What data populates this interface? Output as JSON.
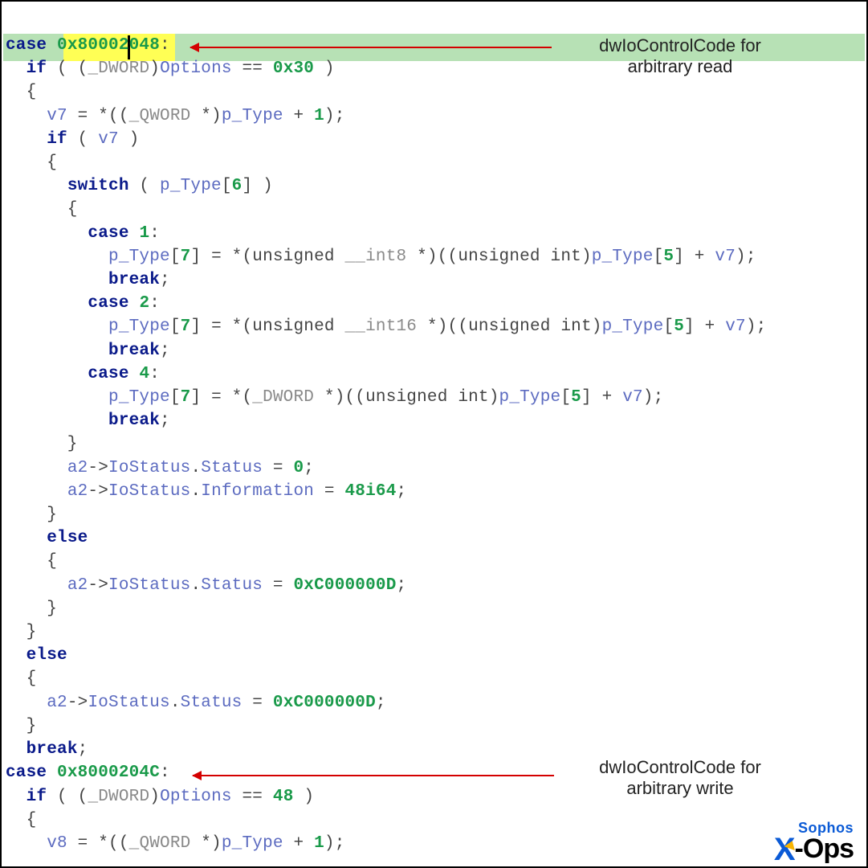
{
  "annotations": {
    "top": {
      "line1": "dwIoControlCode for",
      "line2": "arbitrary read"
    },
    "bottom": {
      "line1": "dwIoControlCode for",
      "line2": "arbitrary write"
    }
  },
  "logo": {
    "brand": "Sophos",
    "product_x": "X",
    "product_rest": "-Ops"
  },
  "code": {
    "l01_a": "case ",
    "l01_b": "0x80002048",
    "l01_c": ":",
    "l02_a": "  ",
    "l02_b": "if",
    "l02_c": " ( (",
    "l02_d": "_DWORD",
    "l02_e": ")",
    "l02_f": "Options",
    "l02_g": " == ",
    "l02_h": "0x30",
    "l02_i": " )",
    "l03": "  {",
    "l04_a": "    ",
    "l04_b": "v7",
    "l04_c": " = *((",
    "l04_d": "_QWORD",
    "l04_e": " *)",
    "l04_f": "p_Type",
    "l04_g": " + ",
    "l04_h": "1",
    "l04_i": ");",
    "l05_a": "    ",
    "l05_b": "if",
    "l05_c": " ( ",
    "l05_d": "v7",
    "l05_e": " )",
    "l06": "    {",
    "l07_a": "      ",
    "l07_b": "switch",
    "l07_c": " ( ",
    "l07_d": "p_Type",
    "l07_e": "[",
    "l07_f": "6",
    "l07_g": "] )",
    "l08": "      {",
    "l09_a": "        ",
    "l09_b": "case",
    "l09_c": " ",
    "l09_d": "1",
    "l09_e": ":",
    "l10_a": "          ",
    "l10_b": "p_Type",
    "l10_c": "[",
    "l10_d": "7",
    "l10_e": "] = *(unsigned ",
    "l10_f": "__int8",
    "l10_g": " *)((unsigned int)",
    "l10_h": "p_Type",
    "l10_i": "[",
    "l10_j": "5",
    "l10_k": "] + ",
    "l10_l": "v7",
    "l10_m": ");",
    "l11_a": "          ",
    "l11_b": "break",
    "l11_c": ";",
    "l12_a": "        ",
    "l12_b": "case",
    "l12_c": " ",
    "l12_d": "2",
    "l12_e": ":",
    "l13_a": "          ",
    "l13_b": "p_Type",
    "l13_c": "[",
    "l13_d": "7",
    "l13_e": "] = *(unsigned ",
    "l13_f": "__int16",
    "l13_g": " *)((unsigned int)",
    "l13_h": "p_Type",
    "l13_i": "[",
    "l13_j": "5",
    "l13_k": "] + ",
    "l13_l": "v7",
    "l13_m": ");",
    "l14_a": "          ",
    "l14_b": "break",
    "l14_c": ";",
    "l15_a": "        ",
    "l15_b": "case",
    "l15_c": " ",
    "l15_d": "4",
    "l15_e": ":",
    "l16_a": "          ",
    "l16_b": "p_Type",
    "l16_c": "[",
    "l16_d": "7",
    "l16_e": "] = *(",
    "l16_f": "_DWORD",
    "l16_g": " *)((unsigned int)",
    "l16_h": "p_Type",
    "l16_i": "[",
    "l16_j": "5",
    "l16_k": "] + ",
    "l16_l": "v7",
    "l16_m": ");",
    "l17_a": "          ",
    "l17_b": "break",
    "l17_c": ";",
    "l18": "      }",
    "l19_a": "      ",
    "l19_b": "a2",
    "l19_c": "->",
    "l19_d": "IoStatus",
    "l19_e": ".",
    "l19_f": "Status",
    "l19_g": " = ",
    "l19_h": "0",
    "l19_i": ";",
    "l20_a": "      ",
    "l20_b": "a2",
    "l20_c": "->",
    "l20_d": "IoStatus",
    "l20_e": ".",
    "l20_f": "Information",
    "l20_g": " = ",
    "l20_h": "48i64",
    "l20_i": ";",
    "l21": "    }",
    "l22_a": "    ",
    "l22_b": "else",
    "l23": "    {",
    "l24_a": "      ",
    "l24_b": "a2",
    "l24_c": "->",
    "l24_d": "IoStatus",
    "l24_e": ".",
    "l24_f": "Status",
    "l24_g": " = ",
    "l24_h": "0xC000000D",
    "l24_i": ";",
    "l25": "    }",
    "l26": "  }",
    "l27_a": "  ",
    "l27_b": "else",
    "l28": "  {",
    "l29_a": "    ",
    "l29_b": "a2",
    "l29_c": "->",
    "l29_d": "IoStatus",
    "l29_e": ".",
    "l29_f": "Status",
    "l29_g": " = ",
    "l29_h": "0xC000000D",
    "l29_i": ";",
    "l30": "  }",
    "l31_a": "  ",
    "l31_b": "break",
    "l31_c": ";",
    "l32_a": "case ",
    "l32_b": "0x8000204C",
    "l32_c": ":",
    "l33_a": "  ",
    "l33_b": "if",
    "l33_c": " ( (",
    "l33_d": "_DWORD",
    "l33_e": ")",
    "l33_f": "Options",
    "l33_g": " == ",
    "l33_h": "48",
    "l33_i": " )",
    "l34": "  {",
    "l35_a": "    ",
    "l35_b": "v8",
    "l35_c": " = *((",
    "l35_d": "_QWORD",
    "l35_e": " *)",
    "l35_f": "p_Type",
    "l35_g": " + ",
    "l35_h": "1",
    "l35_i": ");"
  }
}
